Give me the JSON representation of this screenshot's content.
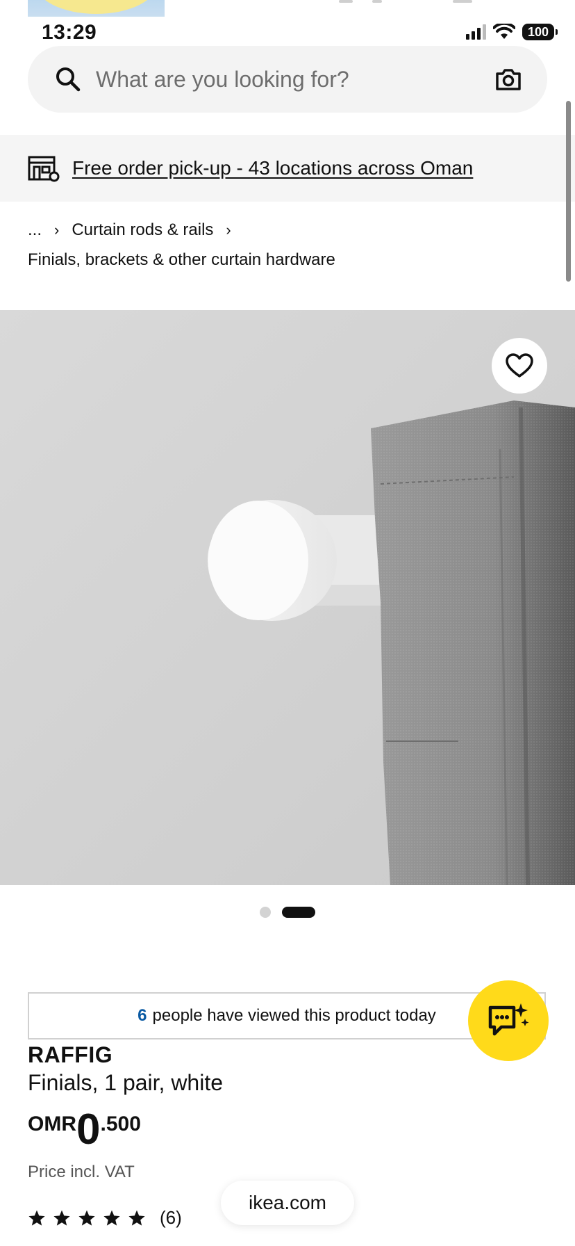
{
  "status_bar": {
    "time": "13:29",
    "battery": "100"
  },
  "search": {
    "placeholder": "What are you looking for?"
  },
  "pickup_banner": {
    "text": "Free order pick-up - 43 locations across Oman"
  },
  "breadcrumb": {
    "ellipsis": "...",
    "separator": "›",
    "parent": "Curtain rods & rails",
    "current": "Finials, brackets & other curtain hardware"
  },
  "carousel": {
    "slides": 2,
    "active_index": 1
  },
  "viewed_notice": {
    "count": "6",
    "text": "people have viewed this product today"
  },
  "product": {
    "name": "RAFFIG",
    "description": "Finials, 1 pair, white",
    "price_currency": "OMR",
    "price_integer": "0",
    "price_decimal": ".500",
    "vat_note": "Price incl. VAT",
    "rating_stars": 5,
    "review_count": "(6)"
  },
  "browser": {
    "url": "ikea.com"
  },
  "colors": {
    "accent_blue": "#0a5aa3",
    "chat_yellow": "#ffda1a",
    "banner_bg": "#f5f5f5",
    "search_bg": "#f3f3f3"
  }
}
